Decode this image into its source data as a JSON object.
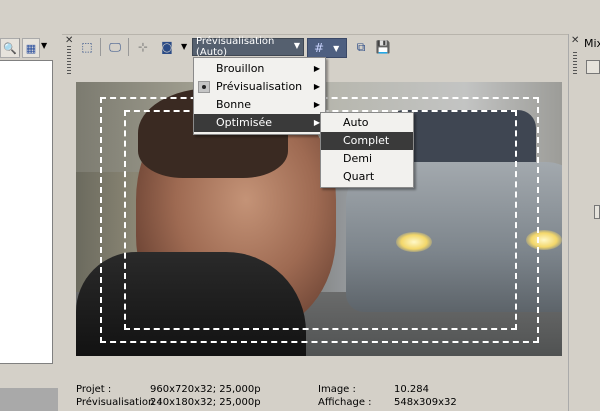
{
  "toolbar": {
    "preview_quality": "Prévisualisation (Auto)",
    "overlay_icon": "grid-icon"
  },
  "quality_menu": {
    "items": [
      {
        "label": "Brouillon"
      },
      {
        "label": "Prévisualisation"
      },
      {
        "label": "Bonne"
      },
      {
        "label": "Optimisée"
      }
    ]
  },
  "resolution_submenu": {
    "items": [
      {
        "label": "Auto"
      },
      {
        "label": "Complet"
      },
      {
        "label": "Demi"
      },
      {
        "label": "Quart"
      }
    ]
  },
  "status": {
    "projet_label": "Projet :",
    "projet_value": "960x720x32; 25,000p",
    "preview_label": "Prévisualisation :",
    "preview_value": "240x180x32; 25,000p",
    "image_label": "Image :",
    "image_value": "10.284",
    "affichage_label": "Affichage :",
    "affichage_value": "548x309x32"
  },
  "right_panel": {
    "title": "Mix"
  },
  "colors": {
    "accent_red": "#9b1c1c",
    "menu_highlight": "#3a3a3a",
    "dropdown_bg": "#55606f"
  }
}
